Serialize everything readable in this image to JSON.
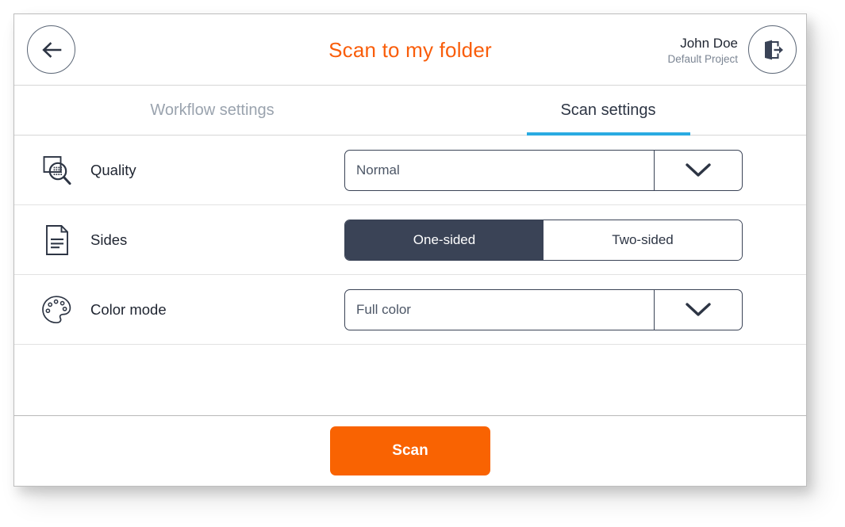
{
  "window": {
    "accent_orange": "#F96302",
    "title_orange": "#F95D0A",
    "tab_underline": "#29ABE2",
    "dark_navy": "#3A4356"
  },
  "header": {
    "title": "Scan to my folder",
    "back_icon": "arrow-left-icon",
    "user_name": "John Doe",
    "user_project": "Default Project",
    "logout_icon": "logout-door-icon"
  },
  "tabs": [
    {
      "label": "Workflow settings",
      "active": false
    },
    {
      "label": "Scan settings",
      "active": true
    }
  ],
  "settings": [
    {
      "id": "quality",
      "icon": "quality-magnifier-icon",
      "label": "Quality",
      "control": "dropdown",
      "value": "Normal",
      "arrow_icon": "chevron-down-icon"
    },
    {
      "id": "sides",
      "icon": "document-page-icon",
      "label": "Sides",
      "control": "toggle",
      "options": [
        {
          "label": "One-sided",
          "selected": true
        },
        {
          "label": "Two-sided",
          "selected": false
        }
      ]
    },
    {
      "id": "color-mode",
      "icon": "color-palette-icon",
      "label": "Color mode",
      "control": "dropdown",
      "value": "Full color",
      "arrow_icon": "chevron-down-icon"
    }
  ],
  "footer": {
    "scan_label": "Scan"
  }
}
